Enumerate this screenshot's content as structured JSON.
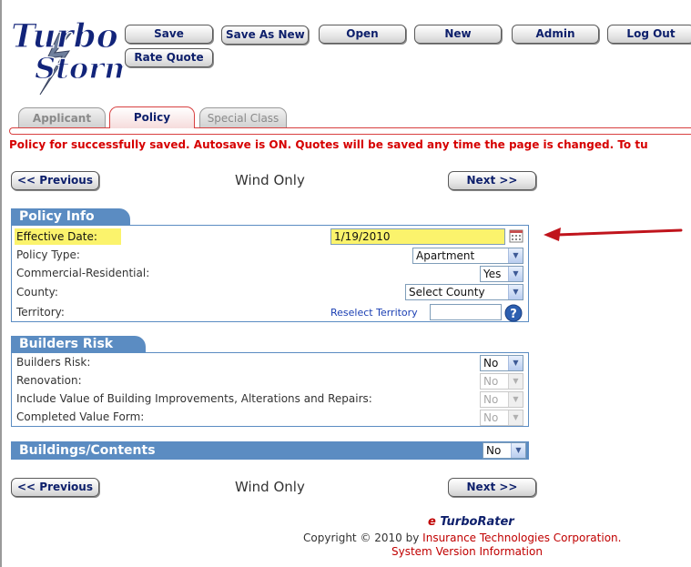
{
  "logo": {
    "line1": "Turbo",
    "line2": "Storm"
  },
  "toolbar": {
    "save": "Save",
    "save_as_new": "Save As New",
    "open": "Open",
    "new": "New",
    "admin": "Admin",
    "log_out": "Log Out",
    "rate_quote": "Rate Quote"
  },
  "tabs": [
    {
      "label": "Applicant",
      "active": false
    },
    {
      "label": "Policy",
      "active": true
    },
    {
      "label": "Special Class",
      "active": false
    }
  ],
  "status_message": "Policy for successfully saved. Autosave is ON. Quotes will be saved any time the page is changed. To tu",
  "nav": {
    "previous": "<< Previous",
    "next": "Next >>",
    "title": "Wind Only"
  },
  "policy_info": {
    "header": "Policy Info",
    "effective_date_label": "Effective Date:",
    "effective_date_value": "1/19/2010",
    "policy_type_label": "Policy Type:",
    "policy_type_value": "Apartment",
    "commercial_residential_label": "Commercial-Residential:",
    "commercial_residential_value": "Yes",
    "county_label": "County:",
    "county_value": "Select County",
    "territory_label": "Territory:",
    "reselect_territory": "Reselect Territory",
    "territory_value": ""
  },
  "builders_risk": {
    "header": "Builders Risk",
    "builders_risk_label": "Builders Risk:",
    "builders_risk_value": "No",
    "renovation_label": "Renovation:",
    "renovation_value": "No",
    "include_value_label": "Include Value of Building Improvements, Alterations and Repairs:",
    "include_value_value": "No",
    "completed_value_label": "Completed Value Form:",
    "completed_value_value": "No"
  },
  "buildings_contents": {
    "header": "Buildings/Contents",
    "value": "No"
  },
  "footer": {
    "brand_e": "e",
    "brand_name": "TurboRater",
    "copyright_prefix": "Copyright © 2010 by",
    "company": "Insurance Technologies Corporation.",
    "system_version": "System Version Information"
  },
  "colors": {
    "section_blue": "#5b8cc2",
    "alert_red": "#d60000",
    "button_text_navy": "#0d1f6b",
    "highlight_yellow": "#fbf36c",
    "arrow_red": "#c0141c"
  }
}
